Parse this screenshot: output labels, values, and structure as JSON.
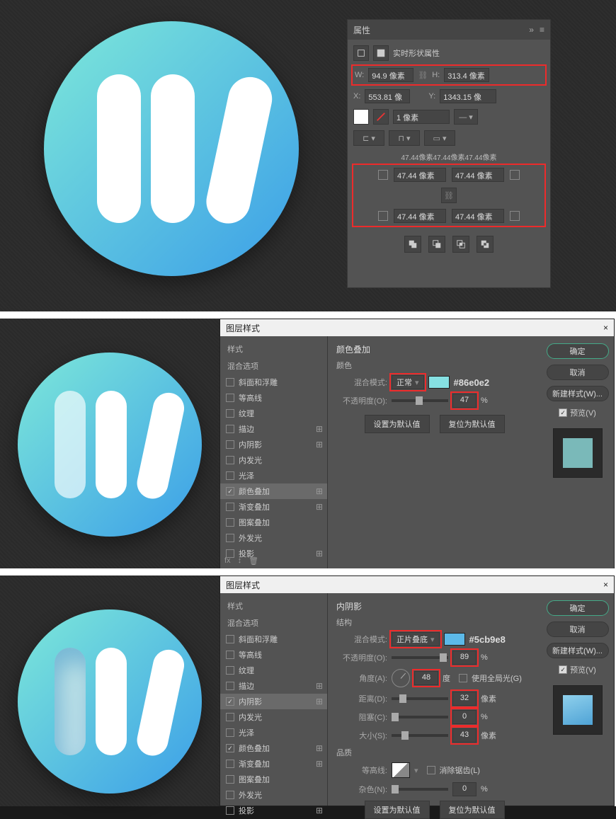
{
  "panel1": {
    "title": "属性",
    "shape_label": "实时形状属性",
    "W_label": "W:",
    "W_value": "94.9 像素",
    "H_label": "H:",
    "H_value": "313.4 像素",
    "X_label": "X:",
    "X_value": "553.81 像",
    "Y_label": "Y:",
    "Y_value": "1343.15 像",
    "stroke_value": "1 像素",
    "corners_header": "47.44像素47.44像素47.44像素",
    "corner_tl": "47.44 像素",
    "corner_tr": "47.44 像素",
    "corner_bl": "47.44 像素",
    "corner_br": "47.44 像素"
  },
  "dialog_a": {
    "title": "图层样式",
    "left_header1": "样式",
    "left_header2": "混合选项",
    "items": [
      "斜面和浮雕",
      "等高线",
      "纹理",
      "描边",
      "内阴影",
      "内发光",
      "光泽",
      "颜色叠加",
      "渐变叠加",
      "图案叠加",
      "外发光",
      "投影"
    ],
    "checked": [
      7
    ],
    "active": 7,
    "mid_title": "颜色叠加",
    "mid_sub": "颜色",
    "blend_label": "混合模式:",
    "blend_value": "正常",
    "opacity_label": "不透明度(O):",
    "opacity_value": "47",
    "opacity_unit": "%",
    "hex": "#86e0e2",
    "btn_default1": "设置为默认值",
    "btn_default2": "复位为默认值",
    "right": {
      "ok": "确定",
      "cancel": "取消",
      "newstyle": "新建样式(W)...",
      "preview": "预览(V)"
    }
  },
  "dialog_b": {
    "title": "图层样式",
    "left_header1": "样式",
    "left_header2": "混合选项",
    "items": [
      "斜面和浮雕",
      "等高线",
      "纹理",
      "描边",
      "内阴影",
      "内发光",
      "光泽",
      "颜色叠加",
      "渐变叠加",
      "图案叠加",
      "外发光",
      "投影"
    ],
    "checked": [
      4,
      7
    ],
    "active": 4,
    "mid_title": "内阴影",
    "mid_sub": "结构",
    "blend_label": "混合模式:",
    "blend_value": "正片叠底",
    "hex": "#5cb9e8",
    "opacity_label": "不透明度(O):",
    "opacity_value": "89",
    "opacity_unit": "%",
    "angle_label": "角度(A):",
    "angle_value": "48",
    "angle_unit": "度",
    "global_label": "使用全局光(G)",
    "distance_label": "距离(D):",
    "distance_value": "32",
    "distance_unit": "像素",
    "choke_label": "阻塞(C):",
    "choke_value": "0",
    "choke_unit": "%",
    "size_label": "大小(S):",
    "size_value": "43",
    "size_unit": "像素",
    "quality_header": "品质",
    "contour_label": "等高线:",
    "antialias_label": "消除锯齿(L)",
    "noise_label": "杂色(N):",
    "noise_value": "0",
    "noise_unit": "%",
    "btn_default1": "设置为默认值",
    "btn_default2": "复位为默认值",
    "right": {
      "ok": "确定",
      "cancel": "取消",
      "newstyle": "新建样式(W)...",
      "preview": "预览(V)"
    }
  }
}
